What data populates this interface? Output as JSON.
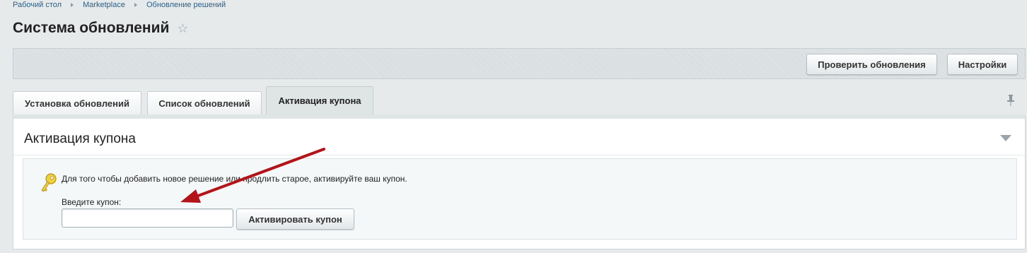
{
  "breadcrumb": [
    "Рабочий стол",
    "Marketplace",
    "Обновление решений"
  ],
  "page": {
    "title": "Система обновлений"
  },
  "toolbar": {
    "check_label": "Проверить обновления",
    "settings_label": "Настройки"
  },
  "tabs": [
    {
      "label": "Установка обновлений",
      "active": false
    },
    {
      "label": "Список обновлений",
      "active": false
    },
    {
      "label": "Активация купона",
      "active": true
    }
  ],
  "panel": {
    "title": "Активация купона",
    "info_text": "Для того чтобы добавить новое решение или продлить старое, активируйте ваш купон.",
    "coupon_label": "Введите купон:",
    "coupon_value": "",
    "activate_label": "Активировать купон"
  },
  "colors": {
    "arrow": "#b3141a",
    "accent_link": "#2c5f86",
    "key": "#e6c12b"
  },
  "icons": [
    "star-icon",
    "pin-icon",
    "collapse-icon",
    "key-icon",
    "arrow-annotation"
  ]
}
